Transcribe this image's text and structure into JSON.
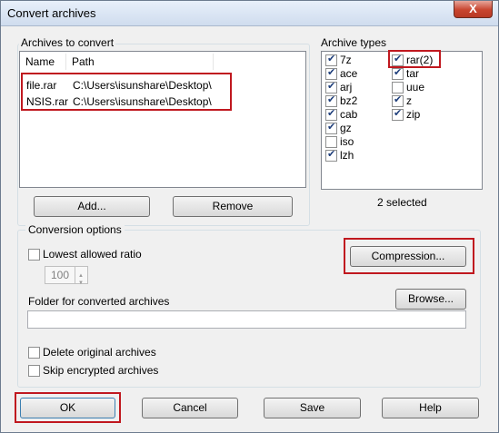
{
  "window": {
    "title": "Convert archives",
    "close_symbol": "X"
  },
  "archives": {
    "group_label": "Archives to convert",
    "columns": [
      "Name",
      "Path"
    ],
    "rows": [
      {
        "name": "file.rar",
        "path": "C:\\Users\\isunshare\\Desktop\\"
      },
      {
        "name": "NSIS.rar",
        "path": "C:\\Users\\isunshare\\Desktop\\"
      }
    ],
    "add_label": "Add...",
    "remove_label": "Remove"
  },
  "types": {
    "group_label": "Archive types",
    "items": [
      {
        "label": "7z",
        "checked": true
      },
      {
        "label": "ace",
        "checked": true
      },
      {
        "label": "arj",
        "checked": true
      },
      {
        "label": "bz2",
        "checked": true
      },
      {
        "label": "cab",
        "checked": true
      },
      {
        "label": "gz",
        "checked": true
      },
      {
        "label": "iso",
        "checked": false
      },
      {
        "label": "lzh",
        "checked": true
      },
      {
        "label": "rar(2)",
        "checked": true
      },
      {
        "label": "tar",
        "checked": true
      },
      {
        "label": "uue",
        "checked": false
      },
      {
        "label": "z",
        "checked": true
      },
      {
        "label": "zip",
        "checked": true
      }
    ],
    "selected_text": "2 selected"
  },
  "conversion": {
    "group_label": "Conversion options",
    "lowest_ratio_label": "Lowest allowed ratio",
    "lowest_ratio_checked": false,
    "ratio_value": "100",
    "compression_label": "Compression...",
    "folder_label": "Folder for converted archives",
    "folder_value": "",
    "browse_label": "Browse...",
    "delete_label": "Delete original archives",
    "delete_checked": false,
    "skip_label": "Skip encrypted archives",
    "skip_checked": false
  },
  "buttons": {
    "ok": "OK",
    "cancel": "Cancel",
    "save": "Save",
    "help": "Help"
  },
  "colors": {
    "highlight_border": "#c0181f",
    "dialog_bg": "#f0f0f0"
  }
}
